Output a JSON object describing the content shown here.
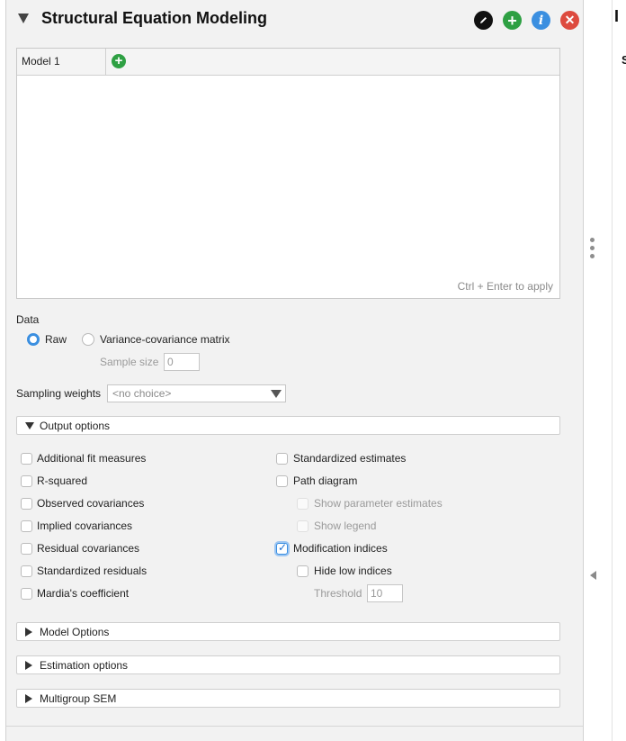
{
  "header": {
    "title": "Structural Equation Modeling",
    "edit_icon": "pencil-icon",
    "add_icon": "plus-icon",
    "add_symbol": "+",
    "info_icon": "info-icon",
    "info_symbol": "i",
    "close_icon": "close-icon",
    "close_symbol": "✕"
  },
  "model": {
    "tab_label": "Model 1",
    "add_tab_symbol": "+",
    "editor_text": "",
    "apply_hint": "Ctrl + Enter to apply"
  },
  "data_section": {
    "label": "Data",
    "raw_label": "Raw",
    "raw_selected": true,
    "varcov_label": "Variance-covariance matrix",
    "sample_size_label": "Sample size",
    "sample_size_value": "0"
  },
  "sampling_weights": {
    "label": "Sampling weights",
    "value": "<no choice>"
  },
  "output_options": {
    "title": "Output options",
    "left": [
      {
        "label": "Additional fit measures",
        "checked": false
      },
      {
        "label": "R-squared",
        "checked": false
      },
      {
        "label": "Observed covariances",
        "checked": false
      },
      {
        "label": "Implied covariances",
        "checked": false
      },
      {
        "label": "Residual covariances",
        "checked": false
      },
      {
        "label": "Standardized residuals",
        "checked": false
      },
      {
        "label": "Mardia's coefficient",
        "checked": false
      }
    ],
    "right": {
      "standardized_estimates": "Standardized estimates",
      "path_diagram": "Path diagram",
      "show_parameter_estimates": "Show parameter estimates",
      "show_legend": "Show legend",
      "modification_indices": "Modification indices",
      "modification_indices_checked": true,
      "hide_low_indices": "Hide low indices",
      "threshold_label": "Threshold",
      "threshold_value": "10"
    }
  },
  "collapsed_sections": {
    "model_options": "Model Options",
    "estimation_options": "Estimation options",
    "multigroup_sem": "Multigroup SEM"
  },
  "right_panel": {
    "cut_char_1": "I",
    "cut_char_2": "S"
  }
}
